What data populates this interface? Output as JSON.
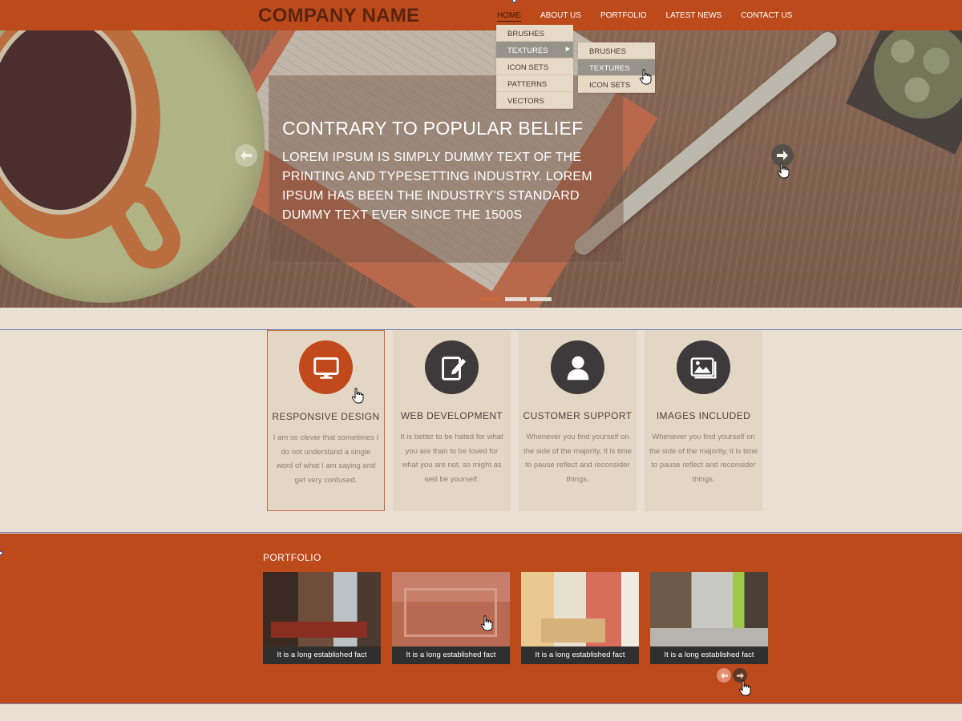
{
  "brand": {
    "name": "COMPANY NAME"
  },
  "nav": {
    "items": [
      {
        "label": "HOME"
      },
      {
        "label": "ABOUT US"
      },
      {
        "label": "PORTFOLIO"
      },
      {
        "label": "LATEST NEWS"
      },
      {
        "label": "CONTACT US"
      }
    ],
    "dropdown": [
      "BRUSHES",
      "TEXTURES",
      "ICON SETS",
      "PATTERNS",
      "VECTORS"
    ],
    "submenu": [
      "BRUSHES",
      "TEXTURES",
      "ICON SETS"
    ]
  },
  "hero": {
    "title": "CONTRARY TO POPULAR BELIEF",
    "text": "LOREM IPSUM IS SIMPLY DUMMY TEXT OF THE PRINTING AND TYPESETTING INDUSTRY. LOREM IPSUM HAS BEEN THE INDUSTRY'S STANDARD DUMMY TEXT EVER SINCE THE 1500S"
  },
  "features": [
    {
      "title": "RESPONSIVE DESIGN",
      "text": "I am so clever that sometimes I do not  understand a single word of what I am saying and get very confused.",
      "icon": "monitor-icon"
    },
    {
      "title": "WEB DEVELOPMENT",
      "text": "It is better to be hated for what you are than to be loved for what you are not, so might as well be yourself.",
      "icon": "edit-icon"
    },
    {
      "title": "CUSTOMER SUPPORT",
      "text": "Whenever you find yourself on the side of the majority, it is time to pause reflect and reconsider things.",
      "icon": "user-icon"
    },
    {
      "title": "IMAGES INCLUDED",
      "text": "Whenever you find yourself on the side of the majority, it is time to pause reflect and reconsider things.",
      "icon": "images-icon"
    }
  ],
  "portfolio": {
    "title": "PORTFOLIO",
    "items": [
      {
        "caption": "It is a long established fact"
      },
      {
        "caption": "It is a long established fact"
      },
      {
        "caption": "It is a long established fact"
      },
      {
        "caption": "It is a long established fact"
      }
    ]
  },
  "colors": {
    "accent": "#bc4a1b",
    "background": "#e9e0d3",
    "card": "#e3d6c4",
    "dark": "#3c3a3a"
  }
}
